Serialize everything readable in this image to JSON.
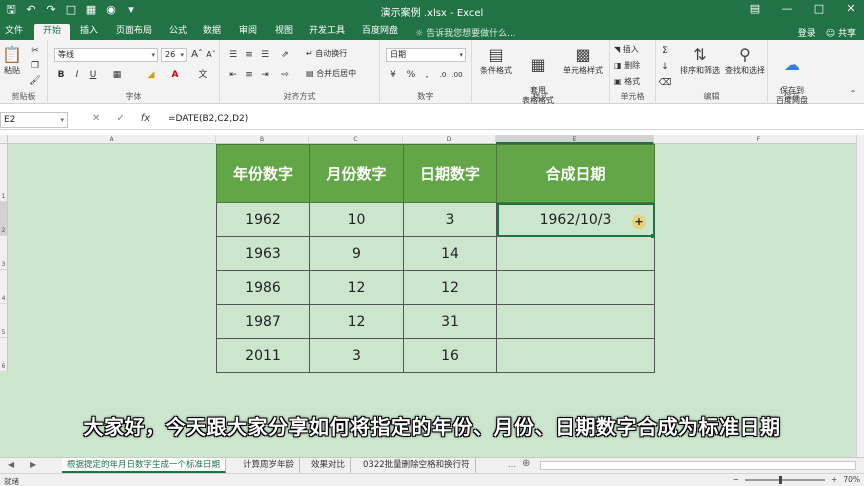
{
  "window": {
    "title": "演示案例 .xlsx - Excel",
    "controls": [
      "restore-ribbon",
      "minimize",
      "maximize",
      "close"
    ]
  },
  "tabs": [
    "文件",
    "开始",
    "插入",
    "页面布局",
    "公式",
    "数据",
    "审阅",
    "视图",
    "开发工具",
    "百度网盘"
  ],
  "active_tab": "开始",
  "tellme": "告诉我您想要做什么...",
  "account": {
    "login": "登录",
    "share": "共享"
  },
  "ribbon": {
    "clipboard": {
      "label": "剪贴板",
      "paste": "粘贴"
    },
    "font": {
      "label": "字体",
      "name": "等线",
      "size": "26",
      "bold": "B",
      "italic": "I",
      "underline": "U"
    },
    "alignment": {
      "label": "对齐方式",
      "wrap": "自动换行",
      "merge": "合并后居中"
    },
    "number": {
      "label": "数字",
      "format": "日期"
    },
    "styles": {
      "label": "样式",
      "conditional": "条件格式",
      "table": "套用\n表格格式",
      "cell": "单元格样式"
    },
    "cells": {
      "label": "单元格",
      "insert": "插入",
      "delete": "删除",
      "format": "格式"
    },
    "editing": {
      "label": "编辑",
      "sort": "排序和筛选",
      "find": "查找和选择"
    },
    "save": {
      "label": "保存",
      "baidu": "保存到\n百度网盘"
    }
  },
  "formula_bar": {
    "name_box": "E2",
    "formula": "=DATE(B2,C2,D2)"
  },
  "columns": [
    "A",
    "B",
    "C",
    "D",
    "E",
    "F"
  ],
  "active_column": "E",
  "rows": [
    "1",
    "2",
    "3",
    "4",
    "5",
    "6"
  ],
  "table": {
    "headers": [
      "年份数字",
      "月份数字",
      "日期数字",
      "合成日期"
    ],
    "rows": [
      [
        "1962",
        "10",
        "3",
        "1962/10/3"
      ],
      [
        "1963",
        "9",
        "14",
        ""
      ],
      [
        "1986",
        "12",
        "12",
        ""
      ],
      [
        "1987",
        "12",
        "31",
        ""
      ],
      [
        "2011",
        "3",
        "16",
        ""
      ]
    ]
  },
  "subtitle": "大家好，今天跟大家分享如何将指定的年份、月份、日期数字合成为标准日期",
  "sheets": [
    "根据提定的年月日数字生成一个标准日期",
    "计算周岁年龄",
    "效果对比",
    "0322批量删除空格和换行符"
  ],
  "active_sheet": 0,
  "status": {
    "mode": "就绪",
    "zoom": "70%"
  }
}
